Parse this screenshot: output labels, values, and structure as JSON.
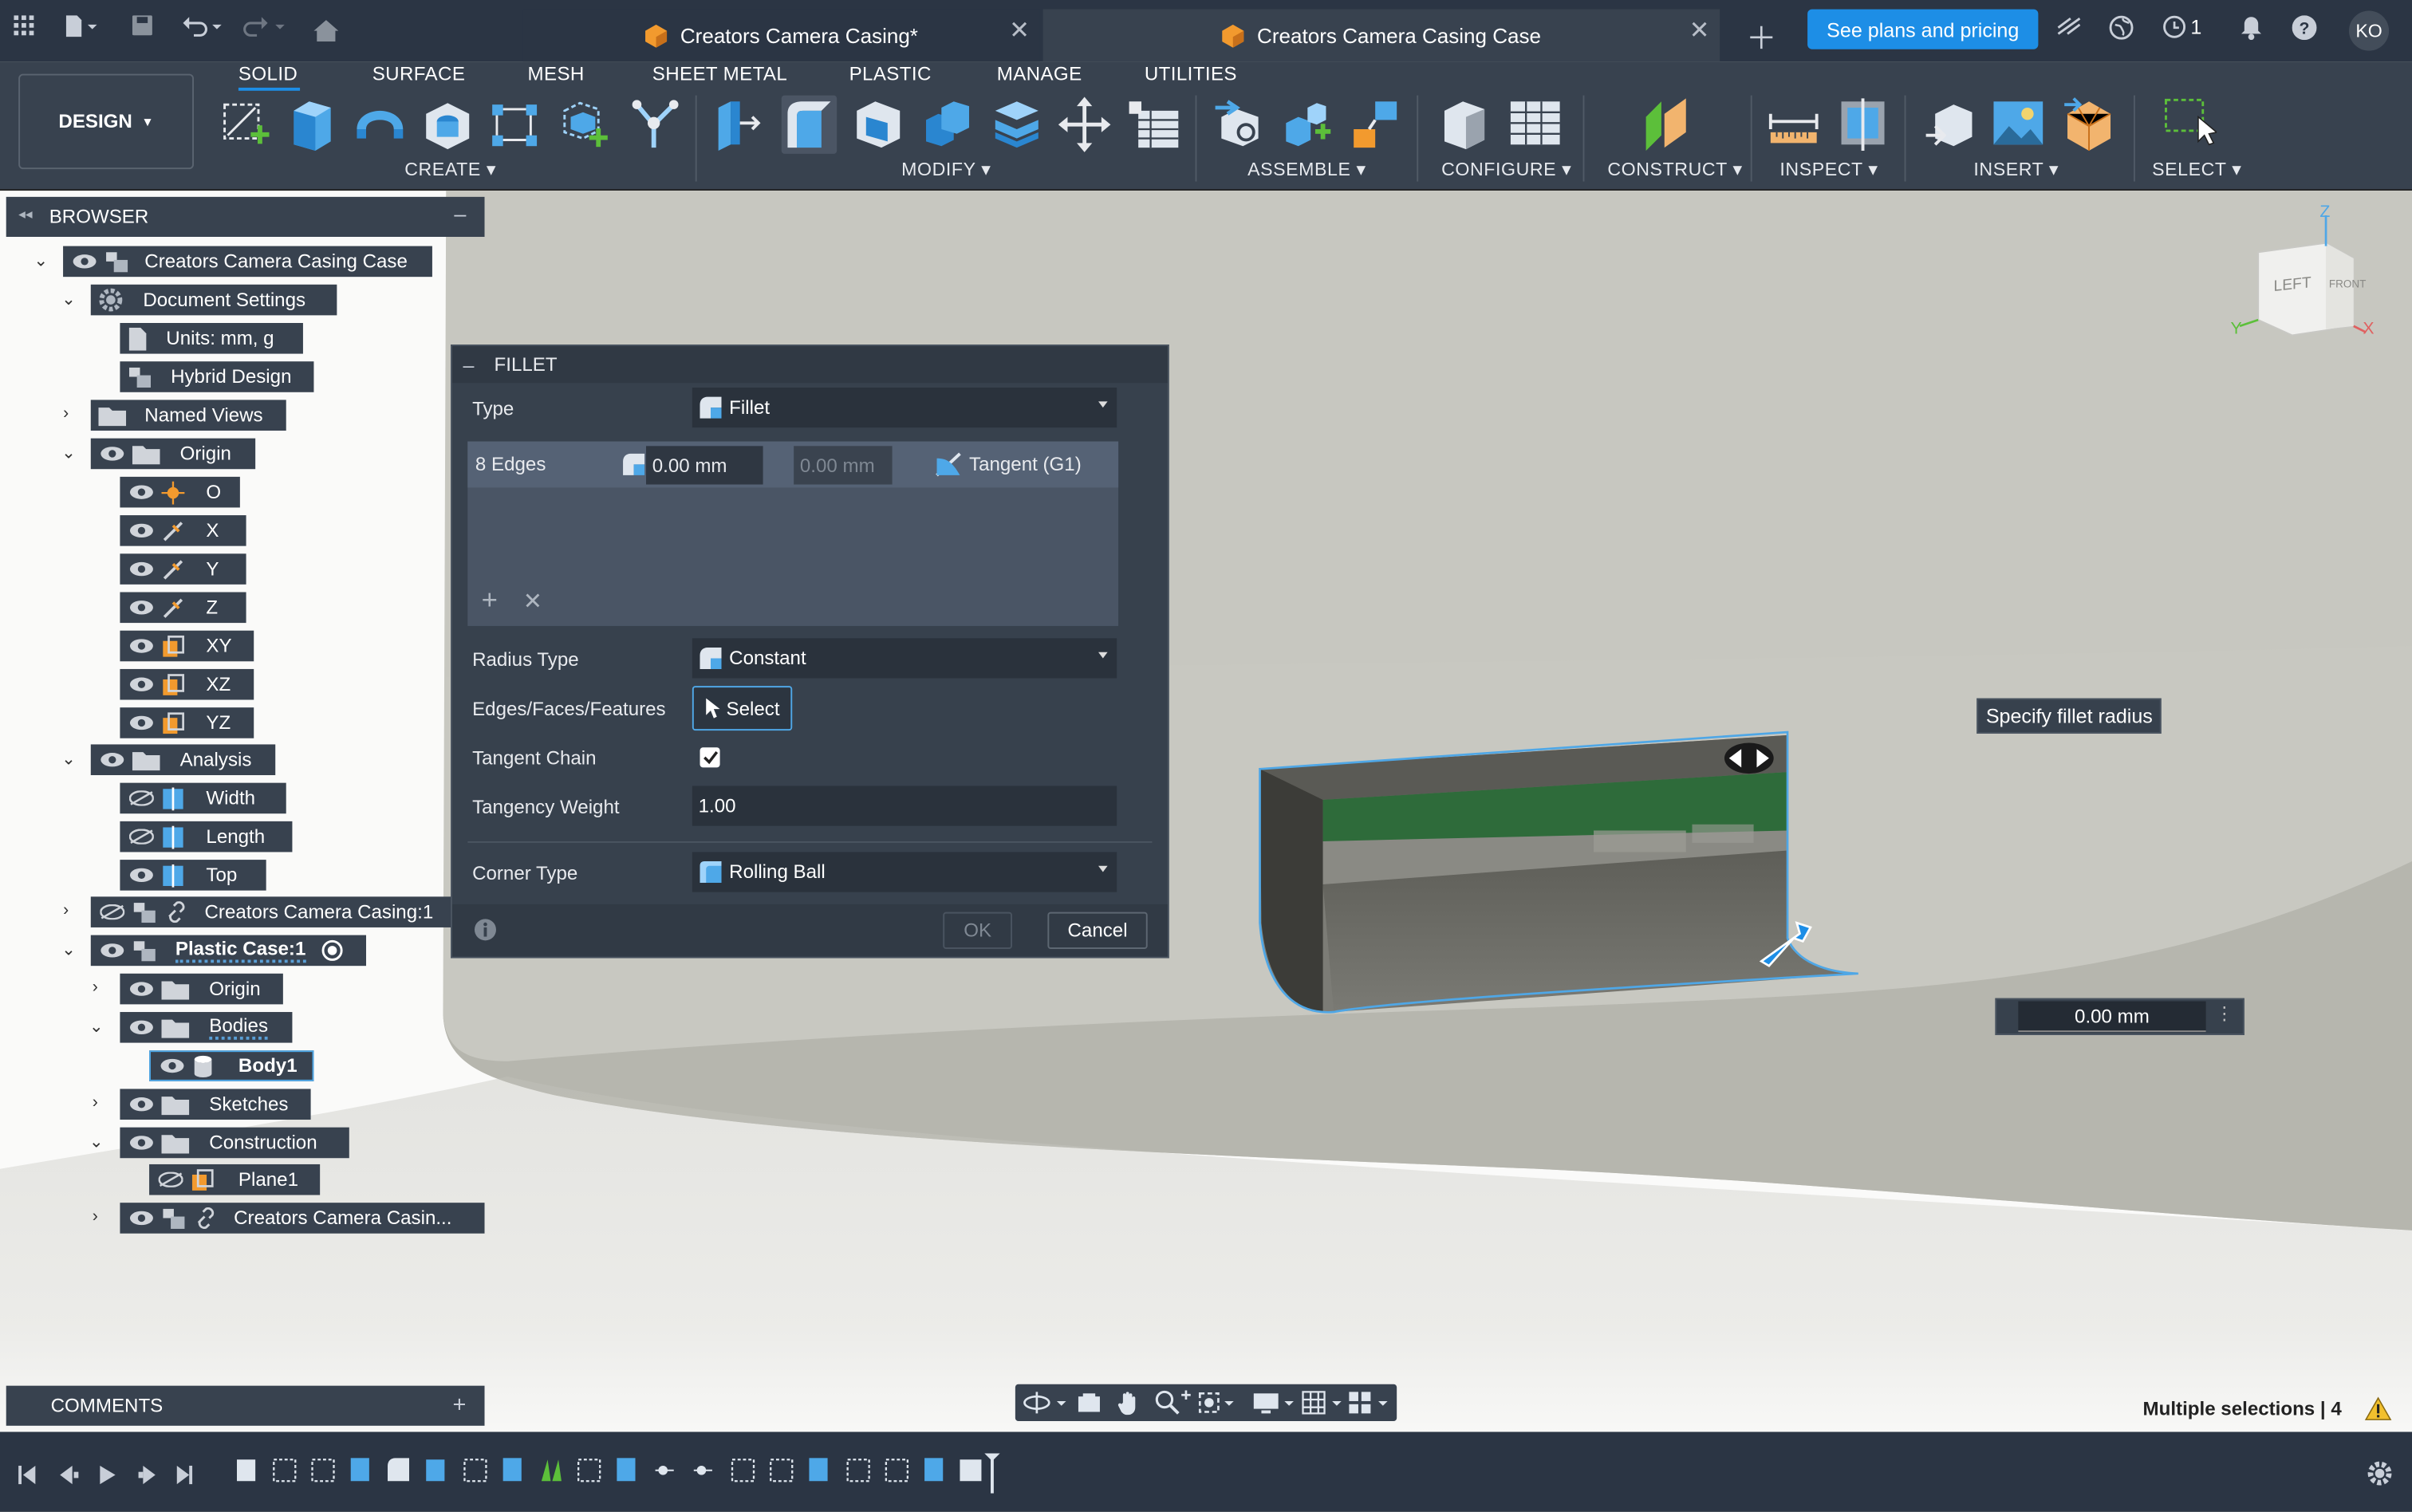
{
  "topbar": {
    "tabs": [
      {
        "label": "Creators Camera Casing*",
        "active": false
      },
      {
        "label": "Creators Camera Casing Case",
        "active": true
      }
    ],
    "plans_button": "See plans and pricing",
    "job_count": "1",
    "user_initials": "KO"
  },
  "toolbar": {
    "workspace": "DESIGN",
    "tabs": [
      "SOLID",
      "SURFACE",
      "MESH",
      "SHEET METAL",
      "PLASTIC",
      "MANAGE",
      "UTILITIES"
    ],
    "groups": [
      "CREATE",
      "MODIFY",
      "ASSEMBLE",
      "CONFIGURE",
      "CONSTRUCT",
      "INSPECT",
      "INSERT",
      "SELECT"
    ]
  },
  "browser": {
    "title": "BROWSER",
    "root": "Creators Camera Casing Case",
    "document_settings": "Document Settings",
    "units": "Units: mm, g",
    "hybrid": "Hybrid Design",
    "named_views": "Named Views",
    "origin": "Origin",
    "origin_items": [
      "O",
      "X",
      "Y",
      "Z",
      "XY",
      "XZ",
      "YZ"
    ],
    "analysis": "Analysis",
    "analysis_items": [
      "Width",
      "Length",
      "Top"
    ],
    "linked_casing": "Creators Camera Casing:1",
    "plastic_case": "Plastic Case:1",
    "pc_origin": "Origin",
    "bodies": "Bodies",
    "body1": "Body1",
    "sketches": "Sketches",
    "construction": "Construction",
    "plane1": "Plane1",
    "linked_casing2": "Creators Camera Casin..."
  },
  "fillet": {
    "title": "FILLET",
    "type_label": "Type",
    "type_value": "Fillet",
    "edges_label": "8 Edges",
    "radius_value": "0.00 mm",
    "radius_secondary": "0.00 mm",
    "continuity": "Tangent (G1)",
    "radius_type_label": "Radius Type",
    "radius_type_value": "Constant",
    "selection_label": "Edges/Faces/Features",
    "select_button": "Select",
    "tangent_chain_label": "Tangent Chain",
    "tangent_chain_checked": true,
    "tangency_weight_label": "Tangency Weight",
    "tangency_weight_value": "1.00",
    "corner_type_label": "Corner Type",
    "corner_type_value": "Rolling Ball",
    "ok": "OK",
    "cancel": "Cancel"
  },
  "viewport": {
    "tooltip": "Specify fillet radius",
    "radius_input": "0.00 mm",
    "viewcube_left": "LEFT",
    "viewcube_front": "FRONT",
    "axis_z": "Z",
    "axis_x": "X",
    "axis_y": "Y",
    "status": "Multiple selections | 4"
  },
  "comments": {
    "title": "COMMENTS"
  },
  "colors": {
    "accent": "#1d8ee6",
    "panel": "#38424f",
    "topbar": "#2b3544",
    "pcb_green": "#2e6b3a"
  }
}
